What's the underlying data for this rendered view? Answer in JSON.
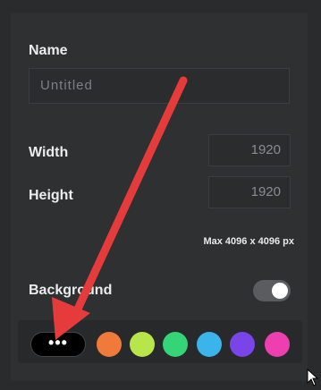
{
  "form": {
    "name_label": "Name",
    "name_placeholder": "Untitled",
    "width_label": "Width",
    "width_value": "1920",
    "height_label": "Height",
    "height_value": "1920",
    "max_hint": "Max 4096 x 4096 px",
    "background_label": "Background",
    "background_toggle_on": true
  },
  "swatches": {
    "more_label": "•••",
    "colors": [
      "#f07a3a",
      "#b7e64a",
      "#35d477",
      "#3ab4ea",
      "#7a45e8",
      "#ee3fb0"
    ]
  },
  "annotation": {
    "arrow_color": "#e53b3b"
  }
}
